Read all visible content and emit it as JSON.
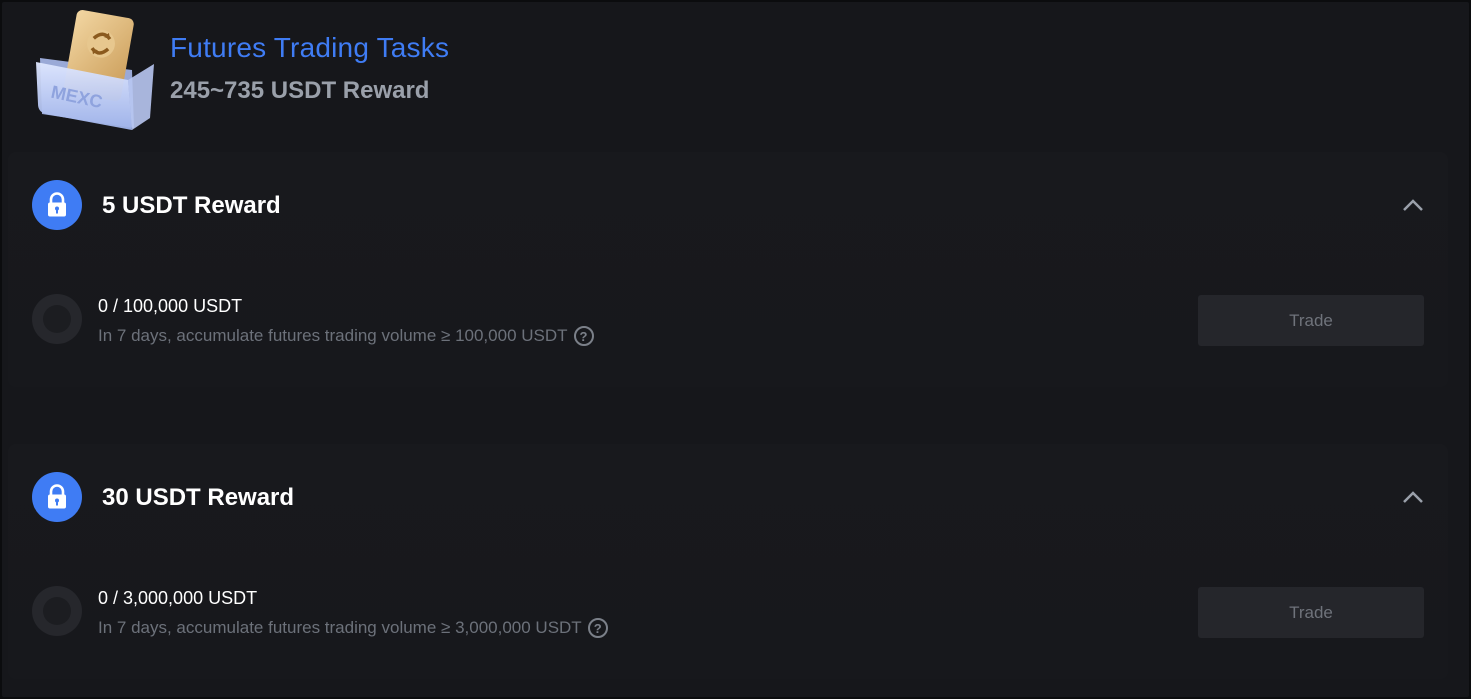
{
  "header": {
    "title": "Futures Trading Tasks",
    "subtitle": "245~735 USDT Reward",
    "logo_text": "MEXC"
  },
  "tasks": [
    {
      "title": "5 USDT Reward",
      "progress": "0 / 100,000 USDT",
      "description": "In 7 days, accumulate futures trading volume ≥ 100,000 USDT",
      "button": "Trade",
      "help": "?"
    },
    {
      "title": "30 USDT Reward",
      "progress": "0 / 3,000,000 USDT",
      "description": "In 7 days, accumulate futures trading volume ≥ 3,000,000 USDT",
      "button": "Trade",
      "help": "?"
    }
  ],
  "icons": {
    "lock": "lock-icon",
    "chevron": "chevron-up-icon",
    "help": "question-circle-icon"
  },
  "colors": {
    "accent": "#3f7cf4",
    "background": "#16171b"
  }
}
